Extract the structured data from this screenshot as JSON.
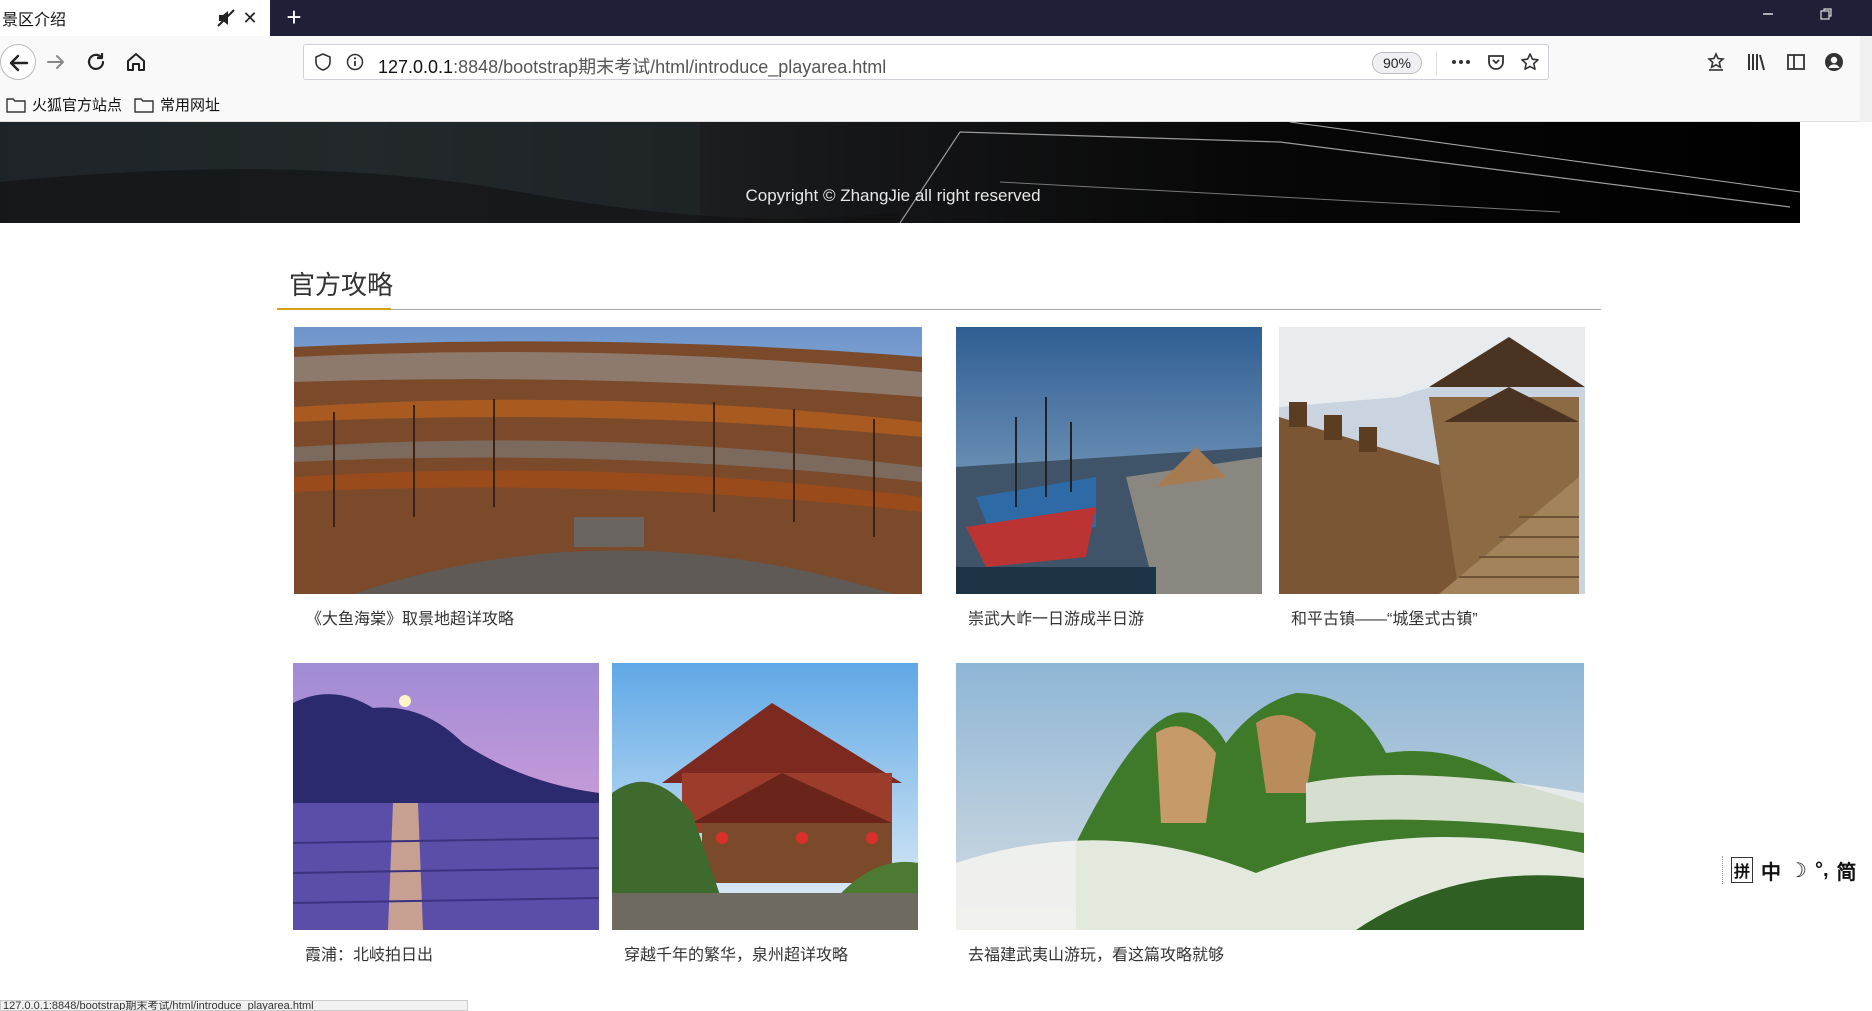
{
  "browser": {
    "tab_title": "景区介绍",
    "newtab_glyph": "+",
    "url_host": "127.0.0.1",
    "url_rest": ":8848/bootstrap期末考试/html/introduce_playarea.html",
    "zoom": "90%",
    "bookmarks": [
      "火狐官方站点",
      "常用网址"
    ],
    "status_text": "127.0.0.1:8848/bootstrap期末考试/html/introduce_playarea.html"
  },
  "page": {
    "banner_copyright": "Copyright © ZhangJie all right reserved",
    "section_title": "官方攻略",
    "cards": [
      {
        "caption": "《大鱼海棠》取景地超详攻略",
        "image": "tulou-roundhouse"
      },
      {
        "caption": "崇武大岞一日游成半日游",
        "image": "harbor-boats"
      },
      {
        "caption": "和平古镇——“城堡式古镇”",
        "image": "ancient-wall-tower"
      },
      {
        "caption": "霞浦：北岐拍日出",
        "image": "sunrise-mudflat"
      },
      {
        "caption": "穿越千年的繁华，泉州超详攻略",
        "image": "temple-roof"
      },
      {
        "caption": "去福建武夷山游玩，看这篇攻略就够",
        "image": "wuyi-mountain-clouds"
      }
    ]
  },
  "ime": {
    "items": [
      "拼",
      "中",
      "简"
    ]
  },
  "colors": {
    "tabbar": "#1f2038",
    "accent_underline": "#d4a017"
  }
}
